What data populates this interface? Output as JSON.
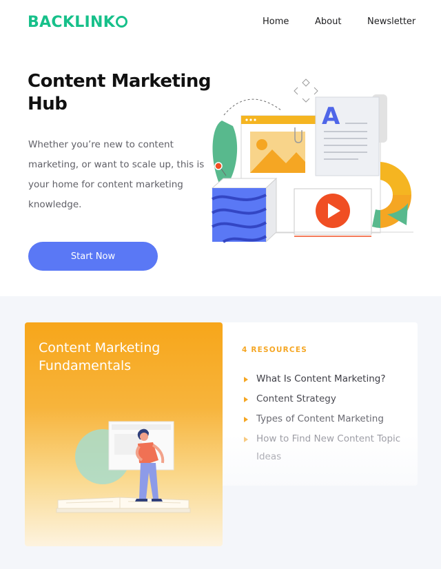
{
  "header": {
    "logo_text": "BACKLINK",
    "nav": [
      {
        "label": "Home"
      },
      {
        "label": "About"
      },
      {
        "label": "Newsletter"
      }
    ]
  },
  "hero": {
    "title": "Content Marketing Hub",
    "description": "Whether you’re new to content marketing, or want to scale up, this is your home for content marketing knowledge.",
    "cta_label": "Start Now",
    "illustration_letter": "A"
  },
  "category_card": {
    "title": "Content Marketing Fundamentals"
  },
  "resources": {
    "count_label": "4 RESOURCES",
    "items": [
      {
        "label": "What Is Content Marketing?"
      },
      {
        "label": "Content Strategy"
      },
      {
        "label": "Types of Content Marketing"
      },
      {
        "label": "How to Find New Content Topic Ideas"
      }
    ]
  },
  "colors": {
    "brand_green": "#17c08a",
    "cta_blue": "#5a78f5",
    "accent_orange": "#f5a623",
    "video_red": "#f04e23"
  },
  "icons": [
    "play-icon",
    "paperclip-icon",
    "image-icon",
    "triangle-bullet-icon"
  ]
}
